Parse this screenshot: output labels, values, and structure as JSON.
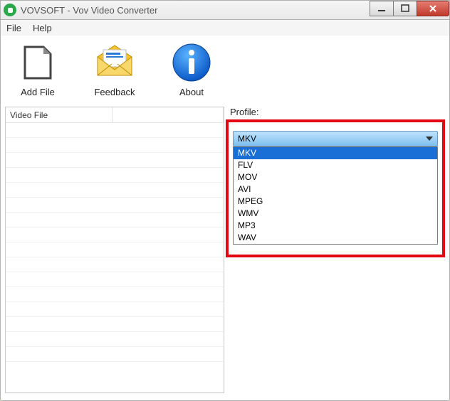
{
  "window": {
    "title": "VOVSOFT - Vov Video Converter"
  },
  "menu": {
    "file": "File",
    "help": "Help"
  },
  "toolbar": {
    "addfile": "Add File",
    "feedback": "Feedback",
    "about": "About"
  },
  "list": {
    "col1": "Video File",
    "col2": ""
  },
  "profile": {
    "label": "Profile:",
    "selected": "MKV",
    "options": [
      "MKV",
      "FLV",
      "MOV",
      "AVI",
      "MPEG",
      "WMV",
      "MP3",
      "WAV"
    ]
  }
}
